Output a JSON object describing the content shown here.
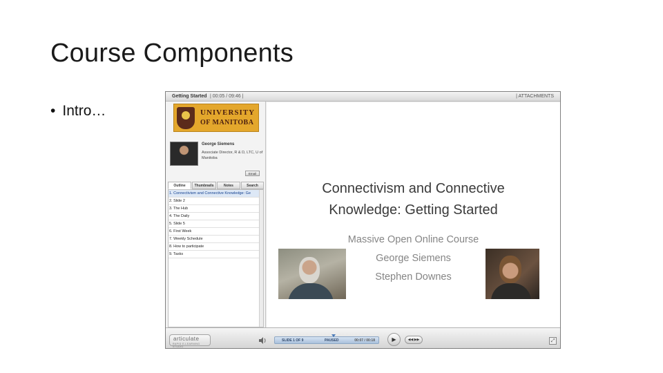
{
  "slide": {
    "title": "Course Components",
    "bullet_marker": "•",
    "bullet_text": "Intro…"
  },
  "player": {
    "title": "Getting Started",
    "time": "| 00:05 / 09:46 |",
    "attachments": "| ATTACHMENTS",
    "logo": {
      "line1": "UNIVERSITY",
      "line2": "OF MANITOBA"
    },
    "presenter": {
      "name": "George Siemens",
      "title": "Associate Director, R & D, LTC, U of Manitoba"
    },
    "email_label": "Email",
    "tabs": [
      "Outline",
      "Thumbnails",
      "Notes",
      "Search"
    ],
    "outline": [
      "1. Connectivism and Connective Knowledge: Ge",
      "2. Slide 2",
      "3. The Hub",
      "4. The Daily",
      "5. Slide 5",
      "6. First Week",
      "7. Weekly Schedule",
      "8. How to participate",
      "9. Tasks"
    ],
    "stage": {
      "title_line1": "Connectivism and Connective",
      "title_line2": "Knowledge: Getting Started",
      "subtitle_line1": "Massive Open Online Course",
      "subtitle_line2": "George Siemens",
      "subtitle_line3": "Stephen Downes"
    },
    "controls": {
      "brand_line1": "articulate",
      "brand_line2": "RAPID E-LEARNING STUDIO",
      "slide_counter": "SLIDE 1 OF 9",
      "status": "PAUSED",
      "progress": "00:07 / 00:18",
      "play_glyph": "▶",
      "nav_glyph": "◀◀ ▶▶",
      "fullscreen_glyph": "⤢"
    }
  }
}
